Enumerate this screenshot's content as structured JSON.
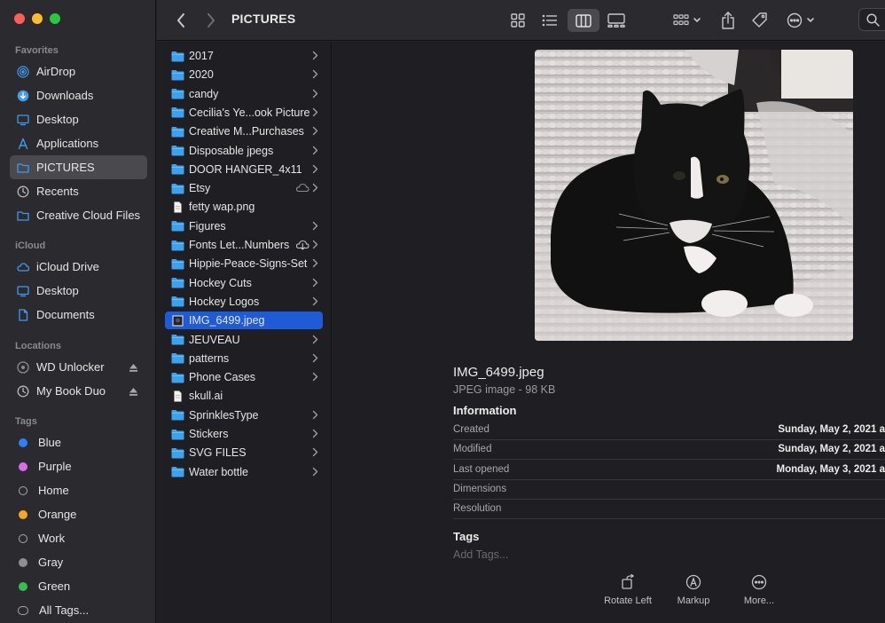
{
  "colors": {
    "accent": "#1f5bd6",
    "folder": "#3aa2f0",
    "tags": {
      "blue": "#2f7ff6",
      "purple": "#d86ee8",
      "orange": "#f5a623",
      "gray": "#8e8e93",
      "green": "#32c24d"
    }
  },
  "sidebar": {
    "favorites_header": "Favorites",
    "favorites": [
      {
        "label": "AirDrop",
        "icon": "airdrop-icon"
      },
      {
        "label": "Downloads",
        "icon": "download-icon"
      },
      {
        "label": "Desktop",
        "icon": "desktop-icon"
      },
      {
        "label": "Applications",
        "icon": "applications-icon"
      },
      {
        "label": "PICTURES",
        "icon": "folder-icon",
        "selected": true
      },
      {
        "label": "Recents",
        "icon": "clock-icon"
      },
      {
        "label": "Creative Cloud Files",
        "icon": "folder-icon"
      }
    ],
    "icloud_header": "iCloud",
    "icloud": [
      {
        "label": "iCloud Drive",
        "icon": "cloud-icon"
      },
      {
        "label": "Desktop",
        "icon": "desktop-icon"
      },
      {
        "label": "Documents",
        "icon": "document-icon"
      }
    ],
    "locations_header": "Locations",
    "locations": [
      {
        "label": "WD Unlocker",
        "icon": "disk-icon"
      },
      {
        "label": "My Book Duo",
        "icon": "clock-icon"
      }
    ],
    "tags_header": "Tags",
    "tags": [
      {
        "label": "Blue",
        "color": "#2f7ff6"
      },
      {
        "label": "Purple",
        "color": "#d86ee8"
      },
      {
        "label": "Home",
        "color": ""
      },
      {
        "label": "Orange",
        "color": "#f5a623"
      },
      {
        "label": "Work",
        "color": ""
      },
      {
        "label": "Gray",
        "color": "#8e8e93"
      },
      {
        "label": "Green",
        "color": "#32c24d"
      },
      {
        "label": "All Tags...",
        "color": "all"
      }
    ]
  },
  "toolbar": {
    "title": "PICTURES"
  },
  "column": {
    "items": [
      {
        "name": "2017",
        "type": "folder",
        "chevron": true
      },
      {
        "name": "2020",
        "type": "folder",
        "chevron": true
      },
      {
        "name": "candy",
        "type": "folder",
        "chevron": true
      },
      {
        "name": "Cecilia's Ye...ook Picture",
        "type": "folder",
        "chevron": true
      },
      {
        "name": "Creative M...Purchases",
        "type": "folder",
        "chevron": true
      },
      {
        "name": "Disposable jpegs",
        "type": "folder",
        "chevron": true
      },
      {
        "name": "DOOR HANGER_4x11",
        "type": "folder",
        "chevron": true
      },
      {
        "name": "Etsy",
        "type": "folder",
        "chevron": true,
        "cloud": "cloud-icon"
      },
      {
        "name": "fetty wap.png",
        "type": "file",
        "chevron": false
      },
      {
        "name": "Figures",
        "type": "folder",
        "chevron": true
      },
      {
        "name": "Fonts Let...Numbers",
        "type": "folder",
        "chevron": true,
        "cloud": "cloud-download-icon"
      },
      {
        "name": "Hippie-Peace-Signs-Set",
        "type": "folder",
        "chevron": true
      },
      {
        "name": "Hockey Cuts",
        "type": "folder",
        "chevron": true
      },
      {
        "name": "Hockey Logos",
        "type": "folder",
        "chevron": true
      },
      {
        "name": "IMG_6499.jpeg",
        "type": "image",
        "chevron": false,
        "selected": true
      },
      {
        "name": "JEUVEAU",
        "type": "folder",
        "chevron": true
      },
      {
        "name": "patterns",
        "type": "folder",
        "chevron": true
      },
      {
        "name": "Phone Cases",
        "type": "folder",
        "chevron": true
      },
      {
        "name": "skull.ai",
        "type": "file",
        "chevron": false
      },
      {
        "name": "SprinklesType",
        "type": "folder",
        "chevron": true
      },
      {
        "name": "Stickers",
        "type": "folder",
        "chevron": true
      },
      {
        "name": "SVG FILES",
        "type": "folder",
        "chevron": true
      },
      {
        "name": "Water bottle",
        "type": "folder",
        "chevron": true
      }
    ]
  },
  "preview": {
    "filename": "IMG_6499.jpeg",
    "kind": "JPEG image - 98 KB",
    "info_header": "Information",
    "info": [
      {
        "label": "Created",
        "value": "Sunday, May 2, 2021 a"
      },
      {
        "label": "Modified",
        "value": "Sunday, May 2, 2021 a"
      },
      {
        "label": "Last opened",
        "value": "Monday, May 3, 2021 a"
      },
      {
        "label": "Dimensions",
        "value": ""
      },
      {
        "label": "Resolution",
        "value": ""
      }
    ],
    "tags_header": "Tags",
    "tags_placeholder": "Add Tags...",
    "actions": [
      {
        "label": "Rotate Left",
        "icon": "rotate-left-icon"
      },
      {
        "label": "Markup",
        "icon": "markup-icon"
      },
      {
        "label": "More...",
        "icon": "more-icon"
      }
    ]
  }
}
